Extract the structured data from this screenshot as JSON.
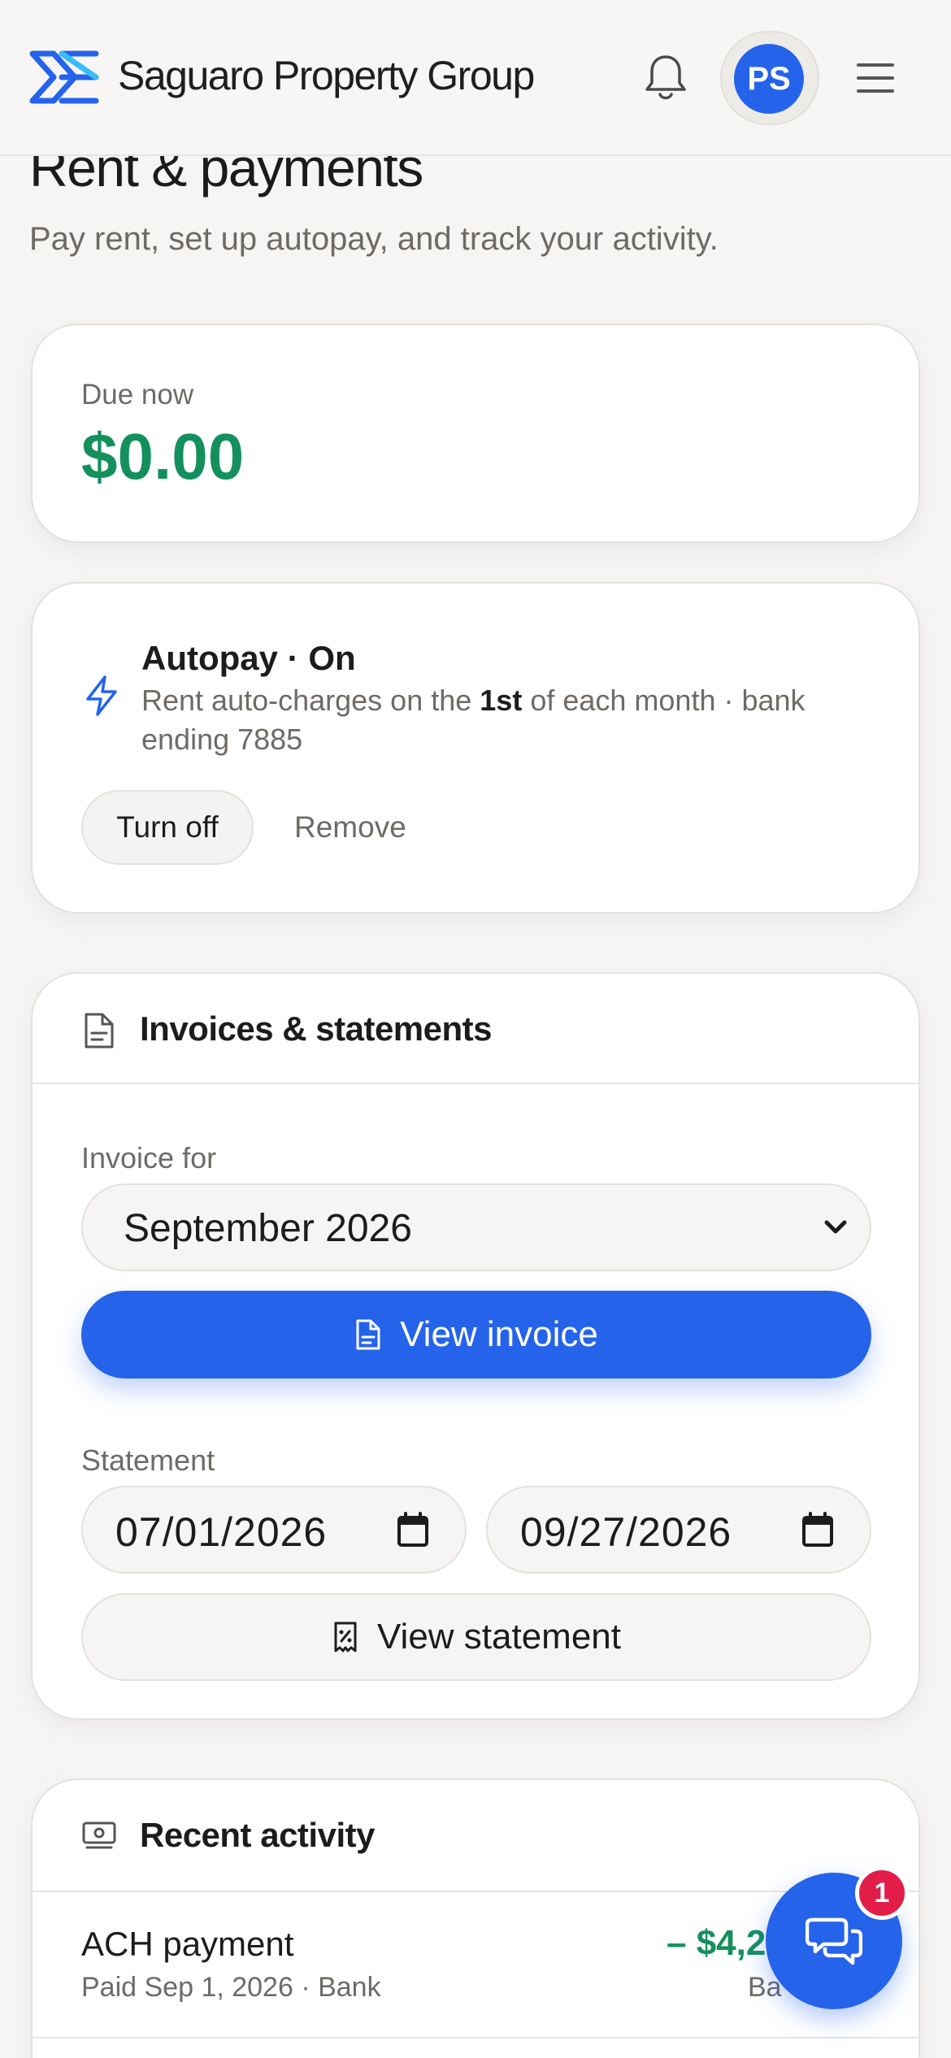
{
  "header": {
    "brand": "Saguaro Property Group",
    "avatar_initials": "PS",
    "icons": [
      "logo-mark",
      "bell-icon",
      "menu-icon"
    ]
  },
  "page": {
    "title": "Rent & payments",
    "subtitle": "Pay rent, set up autopay, and track your activity."
  },
  "due": {
    "label": "Due now",
    "amount": "$0.00"
  },
  "autopay": {
    "title": "Autopay · On",
    "desc_prefix": "Rent auto-charges on the ",
    "desc_bold": "1st",
    "desc_suffix": " of each month · bank ending 7885",
    "turn_off_label": "Turn off",
    "remove_label": "Remove"
  },
  "invoices": {
    "title": "Invoices & statements",
    "invoice_for_label": "Invoice for",
    "selected_month": "September 2026",
    "view_invoice_label": "View invoice",
    "statement_label": "Statement",
    "start_date": "07/01/2026",
    "end_date": "09/27/2026",
    "view_statement_label": "View statement"
  },
  "activity": {
    "title": "Recent activity",
    "rows": [
      {
        "title": "ACH payment",
        "sub": "Paid Sep 1, 2026  · Bank",
        "amount": "– $4,2",
        "method": "Ba"
      }
    ]
  },
  "chat": {
    "badge_count": "1"
  },
  "colors": {
    "accent": "#2563eb",
    "positive": "#13905e",
    "badge": "#e11d48",
    "background": "#f6f5f3"
  }
}
